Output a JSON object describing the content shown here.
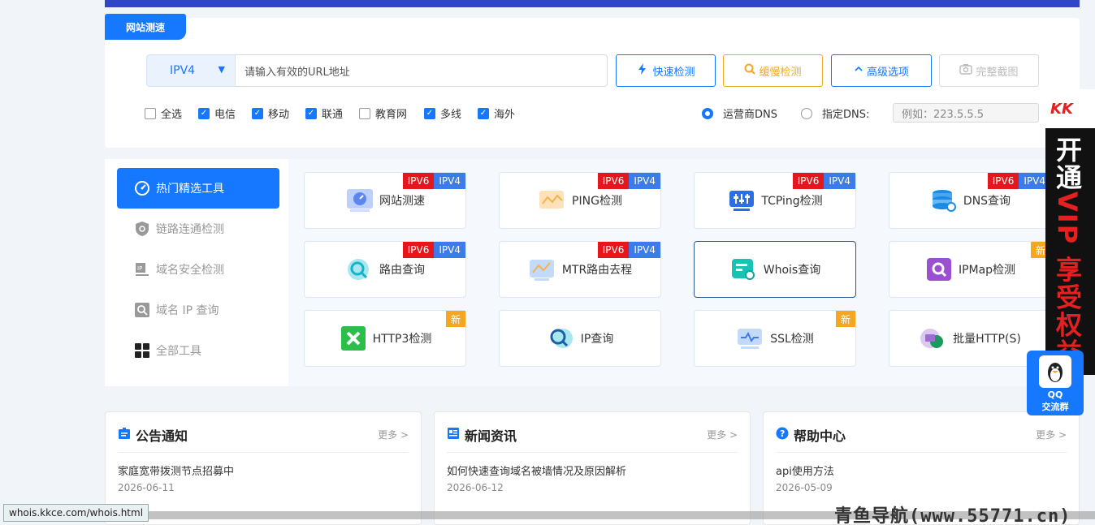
{
  "colors": {
    "primary": "#1677ff",
    "warning": "#f5a623",
    "ipv6": "#e6161f",
    "ipv4": "#3d7be9"
  },
  "search": {
    "tab_label": "网站测速",
    "protocol": "IPV4",
    "url_placeholder": "请输入有效的URL地址",
    "buttons": {
      "fast": "快速检测",
      "slow": "缓慢检测",
      "advanced": "高级选项",
      "screenshot": "完整截图"
    },
    "isps": [
      {
        "label": "全选",
        "checked": false
      },
      {
        "label": "电信",
        "checked": true
      },
      {
        "label": "移动",
        "checked": true
      },
      {
        "label": "联通",
        "checked": true
      },
      {
        "label": "教育网",
        "checked": false
      },
      {
        "label": "多线",
        "checked": true
      },
      {
        "label": "海外",
        "checked": true
      }
    ],
    "dns_options": [
      {
        "label": "运营商DNS",
        "selected": true
      },
      {
        "label": "指定DNS:",
        "selected": false
      }
    ],
    "dns_placeholder": "例如：223.5.5.5"
  },
  "sidebar": {
    "items": [
      {
        "label": "热门精选工具",
        "icon": "gauge-icon",
        "active": true
      },
      {
        "label": "链路连通检测",
        "icon": "shield-icon",
        "active": false
      },
      {
        "label": "域名安全检测",
        "icon": "ip-monitor-icon",
        "active": false
      },
      {
        "label": "域名 IP 查询",
        "icon": "search-box-icon",
        "active": false
      },
      {
        "label": "全部工具",
        "icon": "grid-icon",
        "active": false
      }
    ]
  },
  "tools": [
    {
      "label": "网站测速",
      "icon": "speed-icon",
      "badges": [
        "IPV6",
        "IPV4"
      ]
    },
    {
      "label": "PING检测",
      "icon": "ping-icon",
      "badges": [
        "IPV6",
        "IPV4"
      ]
    },
    {
      "label": "TCPing检测",
      "icon": "tcping-icon",
      "badges": [
        "IPV6",
        "IPV4"
      ]
    },
    {
      "label": "DNS查询",
      "icon": "database-icon",
      "badges": [
        "IPV6",
        "IPV4"
      ]
    },
    {
      "label": "路由查询",
      "icon": "route-icon",
      "badges": [
        "IPV6",
        "IPV4"
      ]
    },
    {
      "label": "MTR路由去程",
      "icon": "mtr-icon",
      "badges": [
        "IPV6",
        "IPV4"
      ]
    },
    {
      "label": "Whois查询",
      "icon": "whois-icon",
      "badges": []
    },
    {
      "label": "IPMap检测",
      "icon": "ipmap-icon",
      "badges": [
        "新"
      ]
    },
    {
      "label": "HTTP3检测",
      "icon": "http3-icon",
      "badges": [
        "新"
      ]
    },
    {
      "label": "IP查询",
      "icon": "ip-search-icon",
      "badges": []
    },
    {
      "label": "SSL检测",
      "icon": "ssl-icon",
      "badges": [
        "新"
      ]
    },
    {
      "label": "批量HTTP(S)",
      "icon": "book-icon",
      "badges": []
    }
  ],
  "panels": [
    {
      "title": "公告通知",
      "icon": "notice-icon",
      "more": "更多 >",
      "item": "家庭宽带拨测节点招募中",
      "date": "2026-06-11"
    },
    {
      "title": "新闻资讯",
      "icon": "news-icon",
      "more": "更多 >",
      "item": "如何快速查询域名被墙情况及原因解析",
      "date": "2026-06-12"
    },
    {
      "title": "帮助中心",
      "icon": "help-icon",
      "more": "更多 >",
      "item": "api使用方法",
      "date": "2026-05-09"
    }
  ],
  "vip": {
    "logo": "KK",
    "text_white": "开通",
    "text_red": "VIP 享受权益"
  },
  "qq": {
    "line1": "QQ",
    "line2": "交流群"
  },
  "status_url": "whois.kkce.com/whois.html",
  "watermark": "青鱼导航(www.55771.cn)"
}
